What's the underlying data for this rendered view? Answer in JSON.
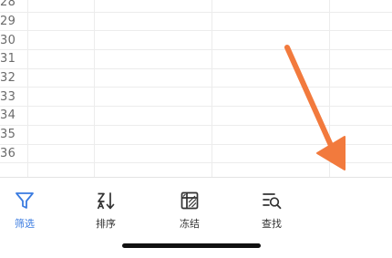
{
  "spreadsheet": {
    "row_numbers": [
      "28",
      "29",
      "30",
      "31",
      "32",
      "33",
      "34",
      "35",
      "36"
    ]
  },
  "toolbar": {
    "filter_label": "筛选",
    "sort_label": "排序",
    "freeze_label": "冻结",
    "find_label": "查找"
  },
  "colors": {
    "active_accent": "#3a7be0",
    "annotation_arrow": "#f27a3d"
  },
  "icons": {
    "filter": "filter-icon",
    "sort": "sort-icon",
    "freeze": "freeze-icon",
    "find": "find-icon"
  }
}
